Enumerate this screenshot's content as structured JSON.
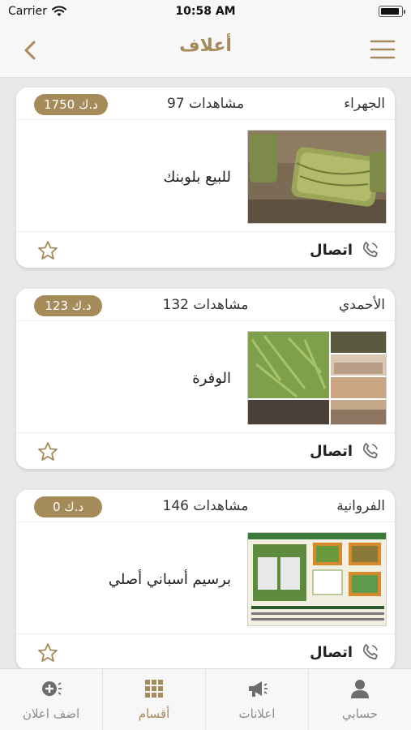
{
  "status_bar": {
    "carrier": "Carrier",
    "time": "10:58 AM",
    "battery_level": 0.9
  },
  "nav": {
    "title": "أعلاف",
    "back_icon": "chevron-left-icon",
    "menu_icon": "hamburger-menu-icon"
  },
  "colors": {
    "accent": "#a58a5a",
    "background": "#e9e9e9",
    "card": "#ffffff"
  },
  "listings": [
    {
      "location": "الجهراء",
      "views": "97 مشاهدات",
      "price": "1750 د.ك",
      "title": "للبيع بلوبنك",
      "call_label": "اتصال",
      "image": "hay-bales-photo"
    },
    {
      "location": "الأحمدي",
      "views": "132 مشاهدات",
      "price": "123 د.ك",
      "title": "الوفرة",
      "call_label": "اتصال",
      "image": "feed-collage-photo"
    },
    {
      "location": "الفروانية",
      "views": "146 مشاهدات",
      "price": "0 د.ك",
      "title": "برسيم أسباني أصلي",
      "call_label": "اتصال",
      "image": "alfalfa-ad-flyer"
    }
  ],
  "tabs": [
    {
      "label": "اضف اعلان",
      "icon": "add-ad-icon",
      "active": false
    },
    {
      "label": "أقسام",
      "icon": "grid-icon",
      "active": true
    },
    {
      "label": "اعلانات",
      "icon": "megaphone-icon",
      "active": false
    },
    {
      "label": "حسابي",
      "icon": "person-icon",
      "active": false
    }
  ]
}
